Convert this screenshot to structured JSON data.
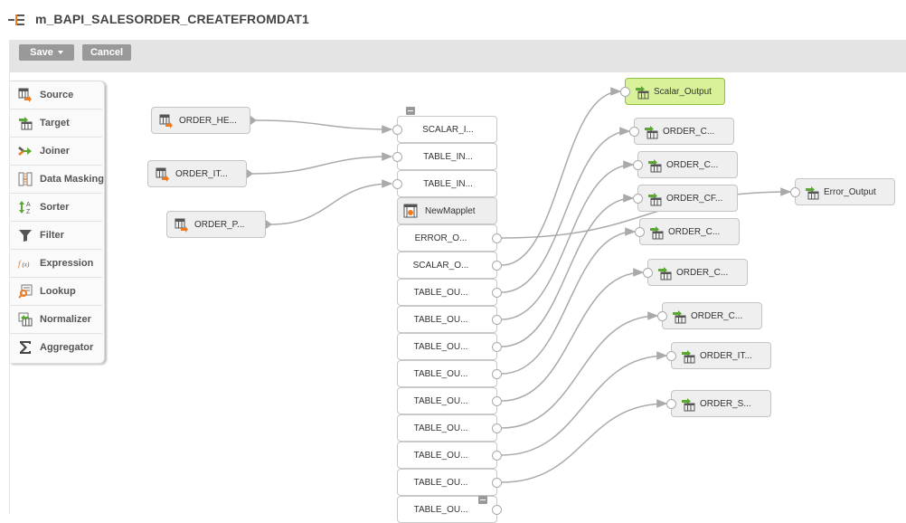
{
  "header": {
    "title": "m_BAPI_SALESORDER_CREATEFROMDAT1",
    "icon": "mapping-icon"
  },
  "toolbar": {
    "save_label": "Save",
    "cancel_label": "Cancel"
  },
  "palette": {
    "items": [
      {
        "label": "Source",
        "icon": "source-icon"
      },
      {
        "label": "Target",
        "icon": "target-icon"
      },
      {
        "label": "Joiner",
        "icon": "joiner-icon"
      },
      {
        "label": "Data Masking",
        "icon": "data-masking-icon"
      },
      {
        "label": "Sorter",
        "icon": "sorter-icon"
      },
      {
        "label": "Filter",
        "icon": "filter-icon"
      },
      {
        "label": "Expression",
        "icon": "expression-icon"
      },
      {
        "label": "Lookup",
        "icon": "lookup-icon"
      },
      {
        "label": "Normalizer",
        "icon": "normalizer-icon"
      },
      {
        "label": "Aggregator",
        "icon": "aggregator-icon"
      }
    ]
  },
  "sources": [
    {
      "label": "ORDER_HE..."
    },
    {
      "label": "ORDER_IT..."
    },
    {
      "label": "ORDER_P..."
    }
  ],
  "mapplet": {
    "name": "NewMapplet",
    "inputs": [
      {
        "label": "SCALAR_I..."
      },
      {
        "label": "TABLE_IN..."
      },
      {
        "label": "TABLE_IN..."
      }
    ],
    "outputs": [
      {
        "label": "ERROR_O..."
      },
      {
        "label": "SCALAR_O..."
      },
      {
        "label": "TABLE_OU..."
      },
      {
        "label": "TABLE_OU..."
      },
      {
        "label": "TABLE_OU..."
      },
      {
        "label": "TABLE_OU..."
      },
      {
        "label": "TABLE_OU..."
      },
      {
        "label": "TABLE_OU..."
      },
      {
        "label": "TABLE_OU..."
      },
      {
        "label": "TABLE_OU..."
      },
      {
        "label": "TABLE_OU..."
      }
    ]
  },
  "targets": [
    {
      "label": "Scalar_Output",
      "highlighted": true
    },
    {
      "label": "ORDER_C..."
    },
    {
      "label": "ORDER_C..."
    },
    {
      "label": "ORDER_CF..."
    },
    {
      "label": "ORDER_C..."
    },
    {
      "label": "ORDER_C..."
    },
    {
      "label": "ORDER_C..."
    },
    {
      "label": "ORDER_IT..."
    },
    {
      "label": "ORDER_S..."
    },
    {
      "label": "Error_Output"
    }
  ],
  "links": [
    {
      "from": "source-0",
      "to": "input-0"
    },
    {
      "from": "source-1",
      "to": "input-1"
    },
    {
      "from": "source-2",
      "to": "input-2"
    },
    {
      "from": "output-0",
      "to": "target-9"
    },
    {
      "from": "output-1",
      "to": "target-0"
    },
    {
      "from": "output-2",
      "to": "target-1"
    },
    {
      "from": "output-3",
      "to": "target-2"
    },
    {
      "from": "output-4",
      "to": "target-3"
    },
    {
      "from": "output-5",
      "to": "target-4"
    },
    {
      "from": "output-6",
      "to": "target-5"
    },
    {
      "from": "output-7",
      "to": "target-6"
    },
    {
      "from": "output-8",
      "to": "target-7"
    },
    {
      "from": "output-9",
      "to": "target-8"
    }
  ],
  "colors": {
    "wire": "#aaaaaa",
    "highlight_fill": "#d9f29a",
    "accent_orange": "#f07b1e",
    "accent_green": "#5aa832"
  }
}
